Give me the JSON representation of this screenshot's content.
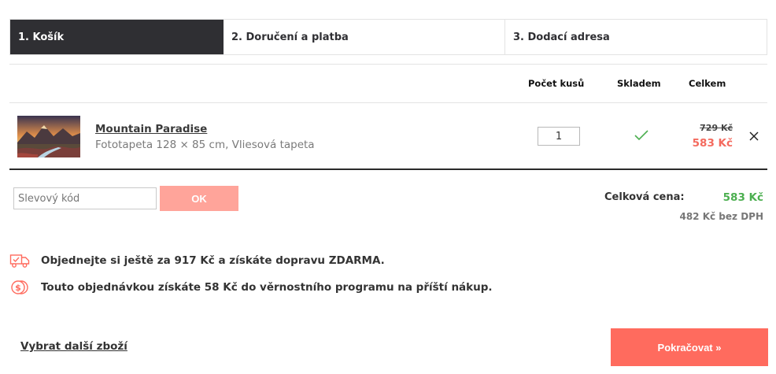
{
  "steps": [
    {
      "label": "1. Košík",
      "active": true
    },
    {
      "label": "2. Doručení a platba",
      "active": false
    },
    {
      "label": "3. Dodací adresa",
      "active": false
    }
  ],
  "table": {
    "col_qty": "Počet kusů",
    "col_stock": "Skladem",
    "col_total": "Celkem"
  },
  "item": {
    "name": "Mountain Paradise",
    "description": "Fototapeta 128 × 85 cm, Vliesová tapeta",
    "quantity": "1",
    "in_stock": true,
    "old_price": "729 Kč",
    "price": "583 Kč",
    "thumbnail_icon": "mountain-landscape-image"
  },
  "coupon": {
    "placeholder": "Slevový kód",
    "button_label": "OK"
  },
  "summary": {
    "total_label": "Celková cena:",
    "total_value": "583 Kč",
    "total_without_vat": "482 Kč bez DPH"
  },
  "info": {
    "shipping_text": "Objednejte si ještě za 917 Kč a získáte dopravu ZDARMA.",
    "shipping_icon": "delivery-truck-icon",
    "loyalty_text": "Touto objednávkou získáte 58 Kč do věrnostního programu na příští nákup.",
    "loyalty_icon": "coins-icon"
  },
  "actions": {
    "continue_shopping": "Vybrat další zboží",
    "proceed": "Pokračovat »"
  },
  "colors": {
    "accent": "#ff6b5e",
    "accent_light": "#ffa49a",
    "dark": "#2f2f33",
    "success": "#4caf50"
  }
}
